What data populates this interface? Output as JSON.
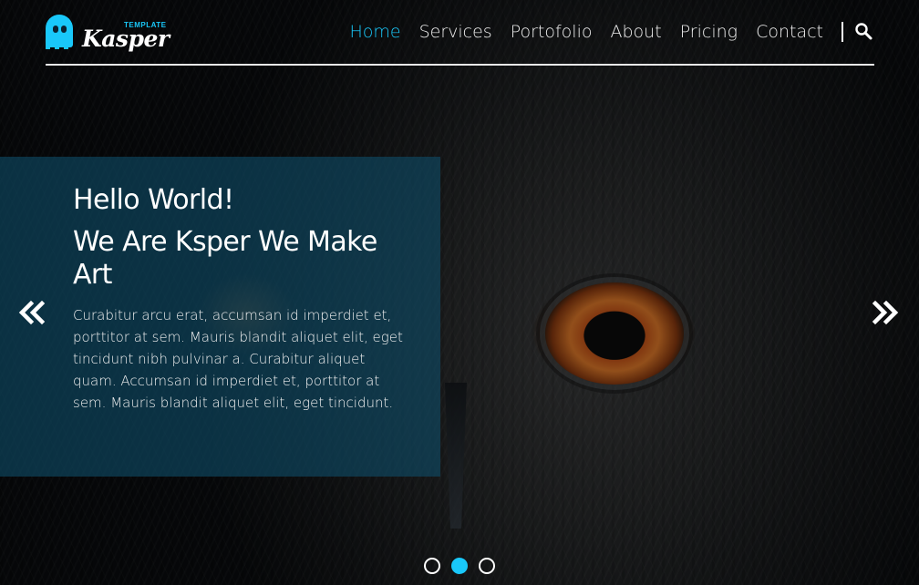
{
  "logo": {
    "name": "Kasper",
    "tag": "TEMPLATE",
    "colors": {
      "accent": "#19c8fa"
    }
  },
  "nav": {
    "items": [
      {
        "label": "Home",
        "active": true
      },
      {
        "label": "Services",
        "active": false
      },
      {
        "label": "Portofolio",
        "active": false
      },
      {
        "label": "About",
        "active": false
      },
      {
        "label": "Pricing",
        "active": false
      },
      {
        "label": "Contact",
        "active": false
      }
    ],
    "search_icon": "search-icon"
  },
  "hero": {
    "heading_1": "Hello World!",
    "heading_2": "We Are Ksper We Make Art",
    "paragraph": "Curabitur arcu erat, accumsan id imperdiet et, porttitor at sem. Mauris blandit aliquet elit, eget tincidunt nibh pulvinar a. Curabitur aliquet quam. Accumsan id imperdiet et, porttitor at sem. Mauris blandit aliquet elit, eget tincidunt.",
    "panel_color": "#0e4c68",
    "prev_icon": "double-chevron-left-icon",
    "next_icon": "double-chevron-right-icon"
  },
  "slider": {
    "bullets": [
      {
        "active": false
      },
      {
        "active": true
      },
      {
        "active": false
      }
    ]
  }
}
